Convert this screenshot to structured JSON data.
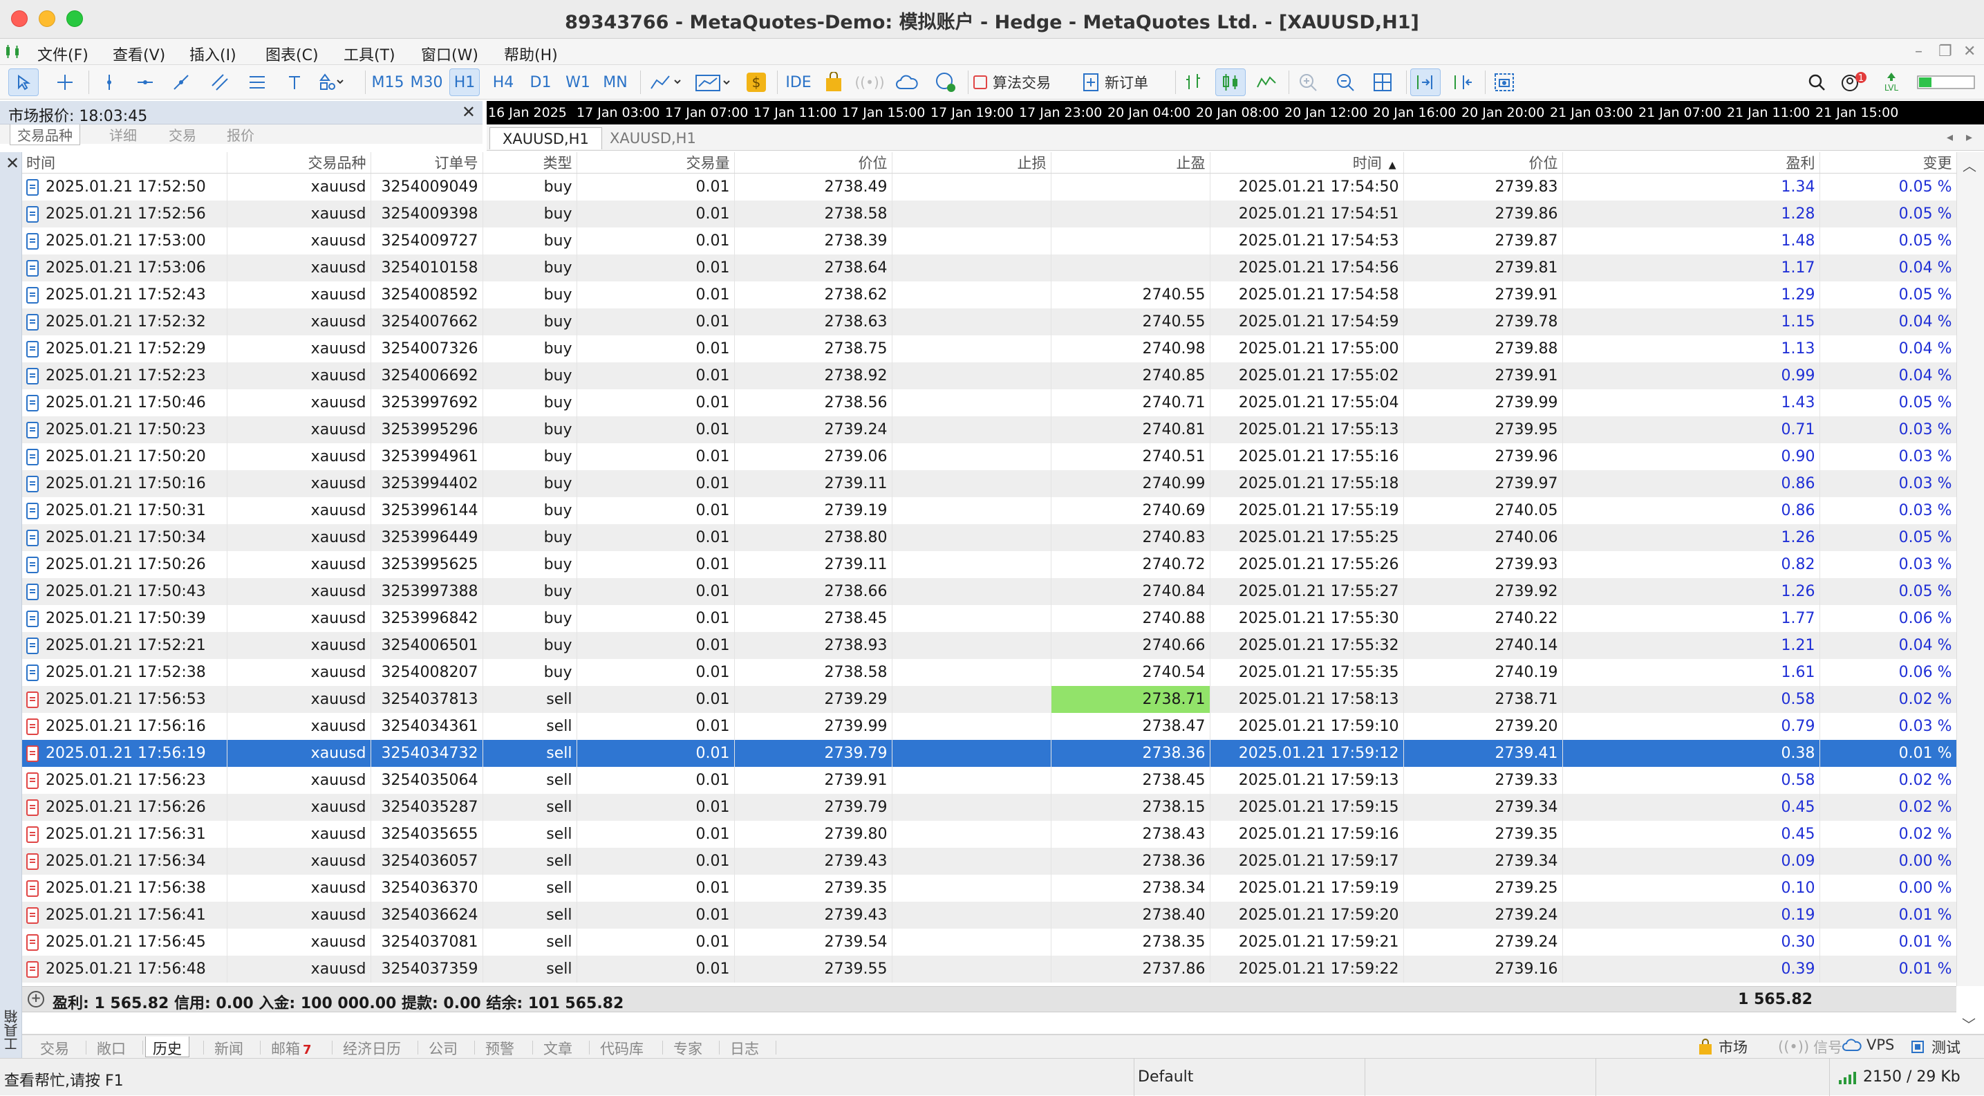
{
  "window": {
    "title": "89343766 - MetaQuotes-Demo: 模拟账户 - Hedge - MetaQuotes Ltd. - [XAUUSD,H1]"
  },
  "menu": [
    "文件(F)",
    "查看(V)",
    "插入(I)",
    "图表(C)",
    "工具(T)",
    "窗口(W)",
    "帮助(H)"
  ],
  "toolbar": {
    "timeframes": [
      "M15",
      "M30",
      "H1",
      "H4",
      "D1",
      "W1",
      "MN"
    ],
    "active_timeframe": "H1",
    "ide_label": "IDE",
    "algo_label": "算法交易",
    "new_order_label": "新订单"
  },
  "market_watch": {
    "title": "市场报价: 18:03:45",
    "tabs": [
      "交易品种",
      "详细",
      "交易",
      "报价"
    ]
  },
  "chart": {
    "axis_labels": [
      "16 Jan 2025",
      "17 Jan 03:00",
      "17 Jan 07:00",
      "17 Jan 11:00",
      "17 Jan 15:00",
      "17 Jan 19:00",
      "17 Jan 23:00",
      "20 Jan 04:00",
      "20 Jan 08:00",
      "20 Jan 12:00",
      "20 Jan 16:00",
      "20 Jan 20:00",
      "21 Jan 03:00",
      "21 Jan 07:00",
      "21 Jan 11:00",
      "21 Jan 15:00"
    ],
    "tabs": [
      "XAUUSD,H1",
      "XAUUSD,H1"
    ]
  },
  "history": {
    "columns": [
      "时间",
      "交易品种",
      "订单号",
      "类型",
      "交易量",
      "价位",
      "止损",
      "止盈",
      "时间",
      "价位",
      "盈利",
      "变更"
    ],
    "rows": [
      [
        "2025.01.21 17:52:50",
        "xauusd",
        "3254009049",
        "buy",
        "0.01",
        "2738.49",
        "",
        "",
        "2025.01.21 17:54:50",
        "2739.83",
        "1.34",
        "0.05 %"
      ],
      [
        "2025.01.21 17:52:56",
        "xauusd",
        "3254009398",
        "buy",
        "0.01",
        "2738.58",
        "",
        "",
        "2025.01.21 17:54:51",
        "2739.86",
        "1.28",
        "0.05 %"
      ],
      [
        "2025.01.21 17:53:00",
        "xauusd",
        "3254009727",
        "buy",
        "0.01",
        "2738.39",
        "",
        "",
        "2025.01.21 17:54:53",
        "2739.87",
        "1.48",
        "0.05 %"
      ],
      [
        "2025.01.21 17:53:06",
        "xauusd",
        "3254010158",
        "buy",
        "0.01",
        "2738.64",
        "",
        "",
        "2025.01.21 17:54:56",
        "2739.81",
        "1.17",
        "0.04 %"
      ],
      [
        "2025.01.21 17:52:43",
        "xauusd",
        "3254008592",
        "buy",
        "0.01",
        "2738.62",
        "",
        "2740.55",
        "2025.01.21 17:54:58",
        "2739.91",
        "1.29",
        "0.05 %"
      ],
      [
        "2025.01.21 17:52:32",
        "xauusd",
        "3254007662",
        "buy",
        "0.01",
        "2738.63",
        "",
        "2740.55",
        "2025.01.21 17:54:59",
        "2739.78",
        "1.15",
        "0.04 %"
      ],
      [
        "2025.01.21 17:52:29",
        "xauusd",
        "3254007326",
        "buy",
        "0.01",
        "2738.75",
        "",
        "2740.98",
        "2025.01.21 17:55:00",
        "2739.88",
        "1.13",
        "0.04 %"
      ],
      [
        "2025.01.21 17:52:23",
        "xauusd",
        "3254006692",
        "buy",
        "0.01",
        "2738.92",
        "",
        "2740.85",
        "2025.01.21 17:55:02",
        "2739.91",
        "0.99",
        "0.04 %"
      ],
      [
        "2025.01.21 17:50:46",
        "xauusd",
        "3253997692",
        "buy",
        "0.01",
        "2738.56",
        "",
        "2740.71",
        "2025.01.21 17:55:04",
        "2739.99",
        "1.43",
        "0.05 %"
      ],
      [
        "2025.01.21 17:50:23",
        "xauusd",
        "3253995296",
        "buy",
        "0.01",
        "2739.24",
        "",
        "2740.81",
        "2025.01.21 17:55:13",
        "2739.95",
        "0.71",
        "0.03 %"
      ],
      [
        "2025.01.21 17:50:20",
        "xauusd",
        "3253994961",
        "buy",
        "0.01",
        "2739.06",
        "",
        "2740.51",
        "2025.01.21 17:55:16",
        "2739.96",
        "0.90",
        "0.03 %"
      ],
      [
        "2025.01.21 17:50:16",
        "xauusd",
        "3253994402",
        "buy",
        "0.01",
        "2739.11",
        "",
        "2740.99",
        "2025.01.21 17:55:18",
        "2739.97",
        "0.86",
        "0.03 %"
      ],
      [
        "2025.01.21 17:50:31",
        "xauusd",
        "3253996144",
        "buy",
        "0.01",
        "2739.19",
        "",
        "2740.69",
        "2025.01.21 17:55:19",
        "2740.05",
        "0.86",
        "0.03 %"
      ],
      [
        "2025.01.21 17:50:34",
        "xauusd",
        "3253996449",
        "buy",
        "0.01",
        "2738.80",
        "",
        "2740.83",
        "2025.01.21 17:55:25",
        "2740.06",
        "1.26",
        "0.05 %"
      ],
      [
        "2025.01.21 17:50:26",
        "xauusd",
        "3253995625",
        "buy",
        "0.01",
        "2739.11",
        "",
        "2740.72",
        "2025.01.21 17:55:26",
        "2739.93",
        "0.82",
        "0.03 %"
      ],
      [
        "2025.01.21 17:50:43",
        "xauusd",
        "3253997388",
        "buy",
        "0.01",
        "2738.66",
        "",
        "2740.84",
        "2025.01.21 17:55:27",
        "2739.92",
        "1.26",
        "0.05 %"
      ],
      [
        "2025.01.21 17:50:39",
        "xauusd",
        "3253996842",
        "buy",
        "0.01",
        "2738.45",
        "",
        "2740.88",
        "2025.01.21 17:55:30",
        "2740.22",
        "1.77",
        "0.06 %"
      ],
      [
        "2025.01.21 17:52:21",
        "xauusd",
        "3254006501",
        "buy",
        "0.01",
        "2738.93",
        "",
        "2740.66",
        "2025.01.21 17:55:32",
        "2740.14",
        "1.21",
        "0.04 %"
      ],
      [
        "2025.01.21 17:52:38",
        "xauusd",
        "3254008207",
        "buy",
        "0.01",
        "2738.58",
        "",
        "2740.54",
        "2025.01.21 17:55:35",
        "2740.19",
        "1.61",
        "0.06 %"
      ],
      [
        "2025.01.21 17:56:53",
        "xauusd",
        "3254037813",
        "sell",
        "0.01",
        "2739.29",
        "",
        "2738.71",
        "2025.01.21 17:58:13",
        "2738.71",
        "0.58",
        "0.02 %"
      ],
      [
        "2025.01.21 17:56:16",
        "xauusd",
        "3254034361",
        "sell",
        "0.01",
        "2739.99",
        "",
        "2738.47",
        "2025.01.21 17:59:10",
        "2739.20",
        "0.79",
        "0.03 %"
      ],
      [
        "2025.01.21 17:56:19",
        "xauusd",
        "3254034732",
        "sell",
        "0.01",
        "2739.79",
        "",
        "2738.36",
        "2025.01.21 17:59:12",
        "2739.41",
        "0.38",
        "0.01 %"
      ],
      [
        "2025.01.21 17:56:23",
        "xauusd",
        "3254035064",
        "sell",
        "0.01",
        "2739.91",
        "",
        "2738.45",
        "2025.01.21 17:59:13",
        "2739.33",
        "0.58",
        "0.02 %"
      ],
      [
        "2025.01.21 17:56:26",
        "xauusd",
        "3254035287",
        "sell",
        "0.01",
        "2739.79",
        "",
        "2738.15",
        "2025.01.21 17:59:15",
        "2739.34",
        "0.45",
        "0.02 %"
      ],
      [
        "2025.01.21 17:56:31",
        "xauusd",
        "3254035655",
        "sell",
        "0.01",
        "2739.80",
        "",
        "2738.43",
        "2025.01.21 17:59:16",
        "2739.35",
        "0.45",
        "0.02 %"
      ],
      [
        "2025.01.21 17:56:34",
        "xauusd",
        "3254036057",
        "sell",
        "0.01",
        "2739.43",
        "",
        "2738.36",
        "2025.01.21 17:59:17",
        "2739.34",
        "0.09",
        "0.00 %"
      ],
      [
        "2025.01.21 17:56:38",
        "xauusd",
        "3254036370",
        "sell",
        "0.01",
        "2739.35",
        "",
        "2738.34",
        "2025.01.21 17:59:19",
        "2739.25",
        "0.10",
        "0.00 %"
      ],
      [
        "2025.01.21 17:56:41",
        "xauusd",
        "3254036624",
        "sell",
        "0.01",
        "2739.43",
        "",
        "2738.40",
        "2025.01.21 17:59:20",
        "2739.24",
        "0.19",
        "0.01 %"
      ],
      [
        "2025.01.21 17:56:45",
        "xauusd",
        "3254037081",
        "sell",
        "0.01",
        "2739.54",
        "",
        "2738.35",
        "2025.01.21 17:59:21",
        "2739.24",
        "0.30",
        "0.01 %"
      ],
      [
        "2025.01.21 17:56:48",
        "xauusd",
        "3254037359",
        "sell",
        "0.01",
        "2739.55",
        "",
        "2737.86",
        "2025.01.21 17:59:22",
        "2739.16",
        "0.39",
        "0.01 %"
      ]
    ],
    "selected_row": 21,
    "highlighted_cell": {
      "row": 19,
      "col": 7,
      "color": "#92e36a"
    },
    "sorted_column": 8
  },
  "summary": {
    "text": "盈利: 1 565.82  信用: 0.00  入金: 100 000.00  提款: 0.00  结余: 101 565.82",
    "total": "1 565.82"
  },
  "bottom_tabs": [
    "交易",
    "敞口",
    "历史",
    "新闻",
    "邮箱",
    "经济日历",
    "公司",
    "预警",
    "文章",
    "代码库",
    "专家",
    "日志"
  ],
  "active_bottom_tab": "历史",
  "mailbox_badge": "7",
  "bottom_right": {
    "market": "市场",
    "signals": "信号",
    "vps": "VPS",
    "tester": "测试"
  },
  "toolbox_label": "工具箱",
  "status": {
    "help": "查看帮忙,请按 F1",
    "profile": "Default",
    "traffic": "2150 / 29 Kb"
  },
  "colors": {
    "selection": "#2f76d2",
    "profit": "#1f2fd6",
    "tp_hit": "#92e36a",
    "buy_icon": "#2a72c7",
    "sell_icon": "#e04545"
  }
}
